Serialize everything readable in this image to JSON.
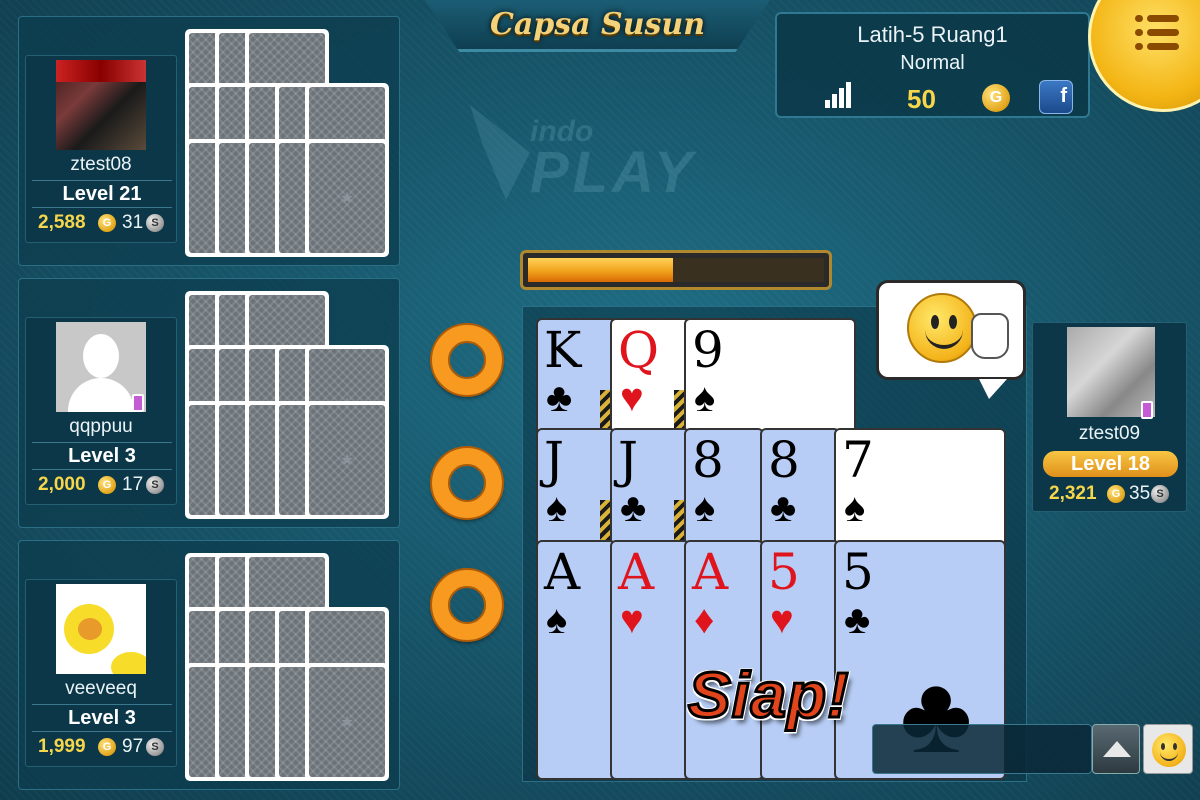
{
  "header": {
    "title": "Capsa Susun",
    "room_name": "Latih-5 Ruang1",
    "room_mode": "Normal",
    "bet_value": "50",
    "coin_symbol": "G",
    "fb_symbol": "f"
  },
  "watermark": {
    "small": "indo",
    "big": "PLAY"
  },
  "players_left": [
    {
      "name": "ztest08",
      "level": "Level 21",
      "gold": "2,588",
      "silver": "31",
      "avatar": "photo-avatar"
    },
    {
      "name": "qqppuu",
      "level": "Level 3",
      "gold": "2,000",
      "silver": "17",
      "avatar": "default-female-avatar"
    },
    {
      "name": "veeveeq",
      "level": "Level 3",
      "gold": "1,999",
      "silver": "97",
      "avatar": "cartoon-avatar"
    }
  ],
  "player_right": {
    "name": "ztest09",
    "level_label": "Level",
    "level_num": "18",
    "gold": "2,321",
    "silver": "35"
  },
  "currency": {
    "gold_symbol": "G",
    "silver_symbol": "S"
  },
  "timer": {
    "fill_fraction": 0.49
  },
  "hands": {
    "top": [
      {
        "rank": "K",
        "suit": "♣",
        "color": "black"
      },
      {
        "rank": "Q",
        "suit": "♥",
        "color": "red"
      },
      {
        "rank": "9",
        "suit": "♠",
        "color": "black"
      }
    ],
    "middle": [
      {
        "rank": "J",
        "suit": "♠",
        "color": "black"
      },
      {
        "rank": "J",
        "suit": "♣",
        "color": "black"
      },
      {
        "rank": "8",
        "suit": "♠",
        "color": "black"
      },
      {
        "rank": "8",
        "suit": "♣",
        "color": "black"
      },
      {
        "rank": "7",
        "suit": "♠",
        "color": "black"
      }
    ],
    "bottom": [
      {
        "rank": "A",
        "suit": "♠",
        "color": "black"
      },
      {
        "rank": "A",
        "suit": "♥",
        "color": "red"
      },
      {
        "rank": "A",
        "suit": "♦",
        "color": "red"
      },
      {
        "rank": "5",
        "suit": "♥",
        "color": "red"
      },
      {
        "rank": "5",
        "suit": "♣",
        "color": "black"
      }
    ]
  },
  "status_text": "Siap!",
  "decor_club": "♣",
  "card_back_symbol": "★",
  "colors": {
    "accent_gold": "#f6d64a",
    "ring_orange": "#f79a1f",
    "table_teal": "#17566b"
  }
}
